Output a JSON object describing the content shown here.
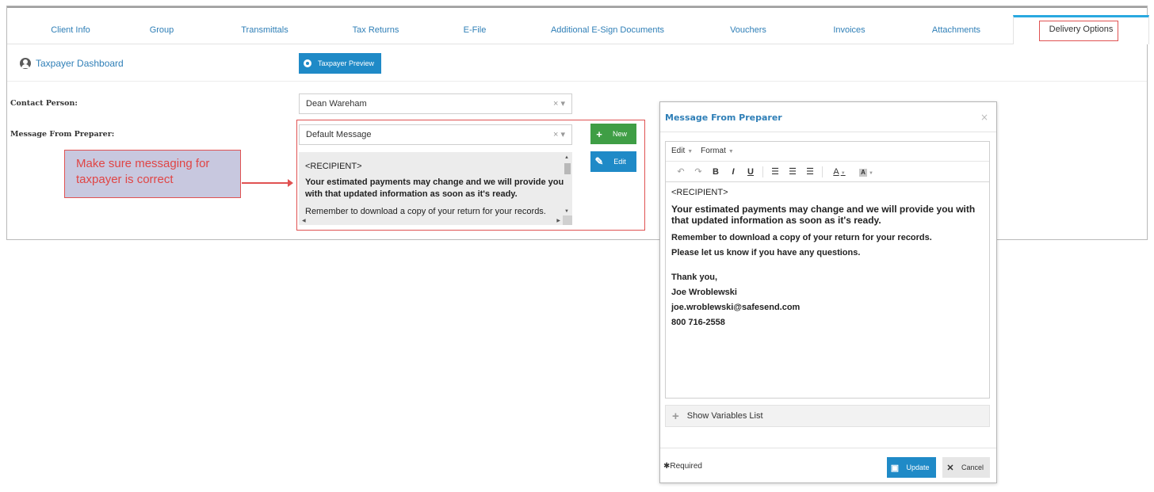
{
  "tabs": [
    {
      "label": "Client Info"
    },
    {
      "label": "Group"
    },
    {
      "label": "Transmittals"
    },
    {
      "label": "Tax Returns"
    },
    {
      "label": "E-File"
    },
    {
      "label": "Additional E-Sign Documents"
    },
    {
      "label": "Vouchers"
    },
    {
      "label": "Invoices"
    },
    {
      "label": "Attachments"
    },
    {
      "label": "Delivery Options",
      "active": true
    }
  ],
  "dashboard": {
    "link": "Taxpayer Dashboard",
    "preview_button": "Taxpayer Preview"
  },
  "form": {
    "contact_label": "Contact Person:",
    "contact_value": "Dean Wareham",
    "message_label": "Message From Preparer:",
    "message_value": "Default Message",
    "preview": {
      "line1": "<RECIPIENT>",
      "line2": "Your estimated payments may change and we will provide you with that updated information as soon as it's ready.",
      "line3": "Remember to download a copy of your return for your records."
    },
    "new_button": "New",
    "edit_button": "Edit"
  },
  "callout": {
    "text": "Make sure messaging for taxpayer is correct",
    "color": "#e04545"
  },
  "modal": {
    "title": "Message From Preparer",
    "menu": {
      "edit": "Edit",
      "format": "Format"
    },
    "content": {
      "recipient": "<RECIPIENT>",
      "p1": "Your estimated payments may change and we will provide you with that updated information as soon as it's ready.",
      "p2": "Remember to download a copy of your return for your records.",
      "p3": "Please let us know if you have any questions.",
      "sign1": "Thank you,",
      "sign2": "Joe Wroblewski",
      "sign3": "joe.wroblewski@safesend.com",
      "sign4": "800 716-2558"
    },
    "variables_label": "Show Variables List",
    "required_label": "Required",
    "update_button": "Update",
    "cancel_button": "Cancel"
  },
  "colors": {
    "primary": "#1f8ac7",
    "success": "#3f9e45",
    "highlight": "#e05252",
    "link": "#2f7fb7"
  }
}
